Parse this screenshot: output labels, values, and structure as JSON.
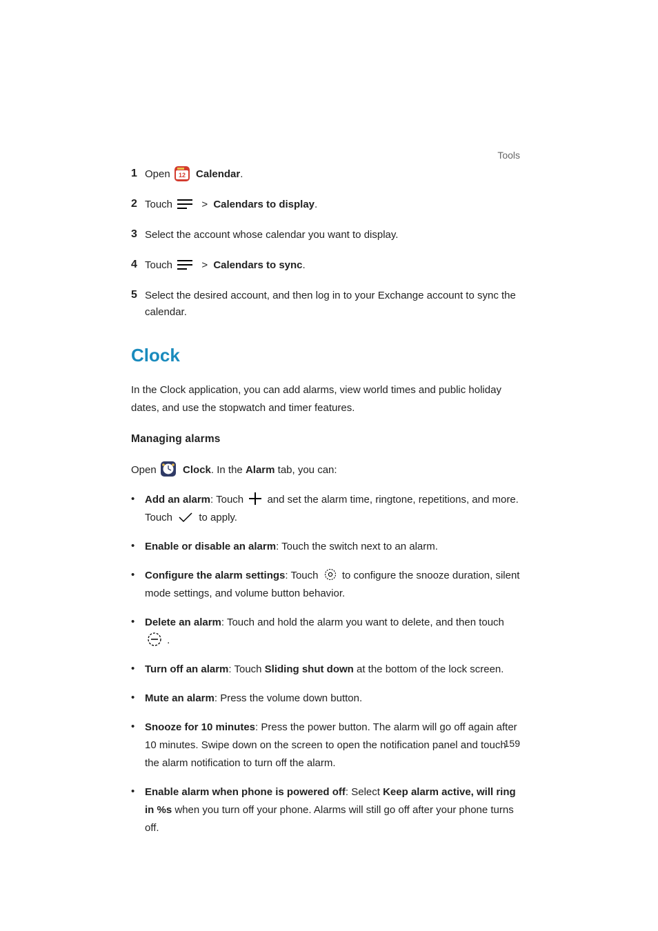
{
  "header": {
    "section": "Tools"
  },
  "pageNumber": "159",
  "steps": [
    {
      "num": "1",
      "pre": "Open ",
      "iconType": "calendar",
      "strong": "Calendar",
      "post": "."
    },
    {
      "num": "2",
      "pre": "Touch ",
      "iconType": "menu",
      "gt": " > ",
      "strong": "Calendars to display",
      "post": "."
    },
    {
      "num": "3",
      "plain": "Select the account whose calendar you want to display."
    },
    {
      "num": "4",
      "pre": "Touch ",
      "iconType": "menu",
      "gt": " > ",
      "strong": "Calendars to sync",
      "post": "."
    },
    {
      "num": "5",
      "plain": "Select the desired account, and then log in to your Exchange account to sync the calendar."
    }
  ],
  "section": {
    "title": "Clock",
    "intro": "In the Clock application, you can add alarms, view world times and public holiday dates, and use the stopwatch and timer features.",
    "subheading": "Managing alarms",
    "open": {
      "pre": "Open ",
      "strong1": "Clock",
      "mid1": ". In the ",
      "strong2": "Alarm",
      "post": " tab, you can:"
    },
    "bullets": [
      {
        "label": "Add an alarm",
        "text1": ": Touch ",
        "icon1": "plus",
        "text2": " and set the alarm time, ringtone, repetitions, and more. Touch ",
        "icon2": "check",
        "text3": " to apply."
      },
      {
        "label": "Enable or disable an alarm",
        "text1": ": Touch the switch next to an alarm."
      },
      {
        "label": "Configure the alarm settings",
        "text1": ": Touch ",
        "icon1": "gear",
        "text2": " to configure the snooze duration, silent mode settings, and volume button behavior."
      },
      {
        "label": "Delete an alarm",
        "text1": ": Touch and hold the alarm you want to delete, and then touch ",
        "icon1": "minuscircle",
        "text2": " ."
      },
      {
        "label": "Turn off an alarm",
        "text1": ": Touch ",
        "strong1": "Sliding shut down",
        "text2": " at the bottom of the lock screen."
      },
      {
        "label": "Mute an alarm",
        "text1": ": Press the volume down button."
      },
      {
        "label": "Snooze for 10 minutes",
        "text1": ": Press the power button. The alarm will go off again after 10 minutes. Swipe down on the screen to open the notification panel and touch the alarm notification to turn off the alarm."
      },
      {
        "label": "Enable alarm when phone is powered off",
        "text1": ": Select ",
        "strong1": "Keep alarm active, will ring in %s",
        "text2": " when you turn off your phone. Alarms will still go off after your phone turns off."
      }
    ]
  }
}
